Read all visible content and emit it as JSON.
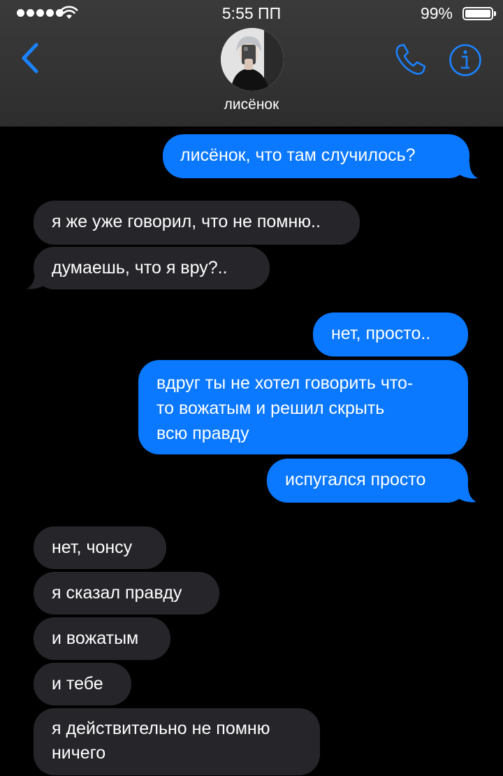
{
  "status_bar": {
    "time": "5:55 ПП",
    "battery": "99%"
  },
  "header": {
    "contact_name": "лисёнок"
  },
  "messages": [
    {
      "dir": "out",
      "text": "лисёнок, что там случилось?"
    },
    {
      "dir": "in",
      "text": "я же уже говорил, что не помню.."
    },
    {
      "dir": "in",
      "text": "думаешь, что я вру?.."
    },
    {
      "dir": "out",
      "text": "нет, просто.."
    },
    {
      "dir": "out",
      "lines": [
        "вдруг ты не хотел говорить что-",
        "то вожатым и решил скрыть",
        "всю правду"
      ]
    },
    {
      "dir": "out",
      "text": "испугался просто"
    },
    {
      "dir": "in",
      "text": "нет, чонсу"
    },
    {
      "dir": "in",
      "text": "я сказал правду"
    },
    {
      "dir": "in",
      "text": "и вожатым"
    },
    {
      "dir": "in",
      "text": "и тебе"
    },
    {
      "dir": "in",
      "lines": [
        "я действительно не помню",
        "ничего"
      ]
    }
  ],
  "colors": {
    "incoming": "#26252a",
    "outgoing": "#0a78ff",
    "accent": "#1a82ff"
  }
}
